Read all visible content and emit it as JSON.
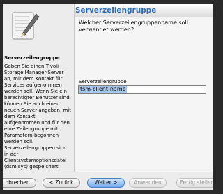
{
  "header": {
    "title": "Serverzeilengruppe"
  },
  "sidebar": {
    "title": "Serverzeilengruppe",
    "text": "Geben Sie einen Tivoli Storage Manager-Server an, mit dem Kontakt für Services aufgenommen werden soll. Wenn Sie ein berechtigter Benutzer sind, können Sie auch einen neuen Server angeben, mit dem Kontakt aufgenommen und für den eine Zeilengruppe mit Parametern begonnen werden soll. Serverzeilengruppen sind in der Clientsystemoptionsdatei (dsm.sys) gespeichert."
  },
  "main": {
    "question": "Welcher Serverzeilengruppenname soll verwendet werden?",
    "field_label": "Serverzeilengruppe",
    "field_value": "tsm-client-name"
  },
  "buttons": {
    "cancel": "bbrechen",
    "back": "< Zurück",
    "next": "Weiter >",
    "apply": "Anwenden",
    "finish": "Fertig stellen"
  }
}
